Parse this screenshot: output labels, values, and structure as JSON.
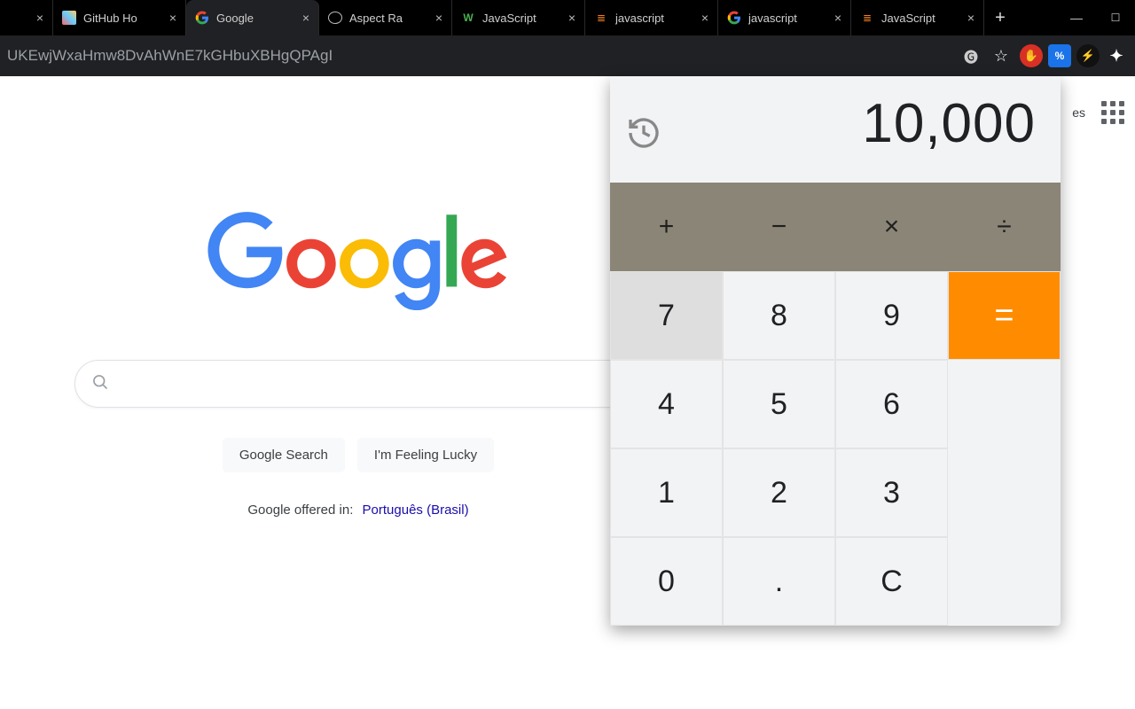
{
  "browser": {
    "tabs": [
      {
        "title": "",
        "closable": true
      },
      {
        "title": "GitHub Ho",
        "closable": true
      },
      {
        "title": "Google",
        "closable": true,
        "active": true
      },
      {
        "title": "Aspect Ra",
        "closable": true
      },
      {
        "title": "JavaScript",
        "closable": true
      },
      {
        "title": "javascript",
        "closable": true
      },
      {
        "title": "javascript",
        "closable": true
      },
      {
        "title": "JavaScript",
        "closable": true
      }
    ],
    "newtab": "+",
    "win_minimize": "—",
    "url": "UKEwjWxaHmw8DvAhWnE7kGHbuXBHgQPAgI",
    "ext_percent": "%"
  },
  "topright": {
    "images": "es"
  },
  "google": {
    "search_button": "Google Search",
    "lucky_button": "I'm Feeling Lucky",
    "offered_prefix": "Google offered in:",
    "offered_lang": "Português (Brasil)"
  },
  "calc": {
    "display": "10,000",
    "ops": {
      "add": "+",
      "sub": "−",
      "mul": "×",
      "div": "÷"
    },
    "keys": {
      "k7": "7",
      "k8": "8",
      "k9": "9",
      "k4": "4",
      "k5": "5",
      "k6": "6",
      "k1": "1",
      "k2": "2",
      "k3": "3",
      "k0": "0",
      "dot": ".",
      "clear": "C",
      "eq": "="
    }
  }
}
